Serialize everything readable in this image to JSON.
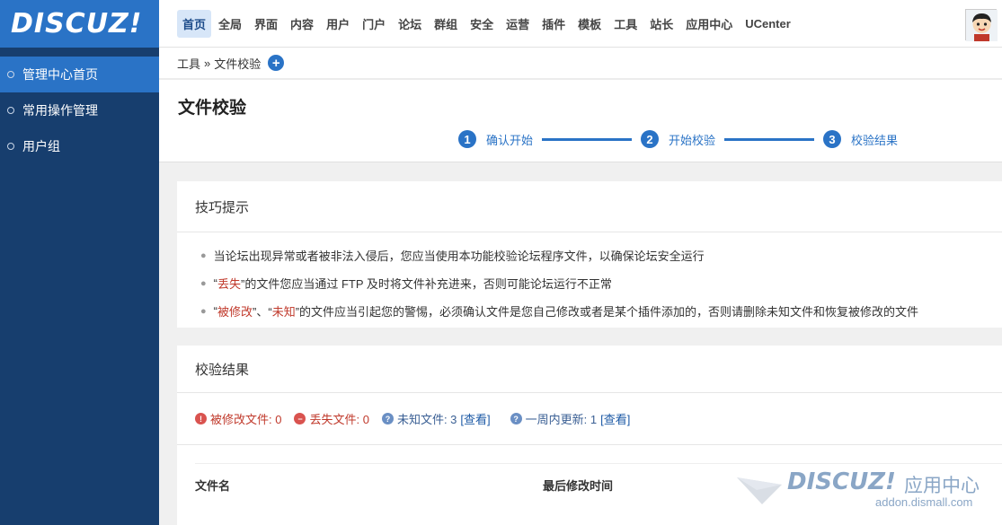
{
  "logo": {
    "text": "DISCUZ!"
  },
  "sidebar": {
    "items": [
      {
        "label": "管理中心首页"
      },
      {
        "label": "常用操作管理"
      },
      {
        "label": "用户组"
      }
    ]
  },
  "topnav": {
    "items": [
      {
        "label": "首页"
      },
      {
        "label": "全局"
      },
      {
        "label": "界面"
      },
      {
        "label": "内容"
      },
      {
        "label": "用户"
      },
      {
        "label": "门户"
      },
      {
        "label": "论坛"
      },
      {
        "label": "群组"
      },
      {
        "label": "安全"
      },
      {
        "label": "运营"
      },
      {
        "label": "插件"
      },
      {
        "label": "模板"
      },
      {
        "label": "工具"
      },
      {
        "label": "站长"
      },
      {
        "label": "应用中心"
      },
      {
        "label": "UCenter"
      }
    ]
  },
  "breadcrumb": {
    "parent": "工具",
    "separator": "»",
    "current": "文件校验"
  },
  "page": {
    "title": "文件校验"
  },
  "steps": [
    {
      "num": "1",
      "label": "确认开始"
    },
    {
      "num": "2",
      "label": "开始校验"
    },
    {
      "num": "3",
      "label": "校验结果"
    }
  ],
  "tips": {
    "title": "技巧提示",
    "items": [
      {
        "text": "当论坛出现异常或者被非法入侵后，您应当使用本功能校验论坛程序文件，以确保论坛安全运行"
      },
      {
        "pre": "“",
        "red": "丢失",
        "text": "”的文件您应当通过 FTP 及时将文件补充进来，否则可能论坛运行不正常"
      },
      {
        "pre": "“",
        "red": "被修改",
        "mid": "”、“",
        "red2": "未知",
        "text": "”的文件应当引起您的警惕，必须确认文件是您自己修改或者是某个插件添加的，否则请删除未知文件和恢复被修改的文件"
      }
    ]
  },
  "results": {
    "title": "校验结果",
    "modified": "被修改文件: 0",
    "lost": "丢失文件: 0",
    "unknown": "未知文件: 3",
    "unknown_link": "[查看]",
    "week": "一周内更新: 1",
    "week_link": "[查看]",
    "col_name": "文件名",
    "col_time": "最后修改时间"
  },
  "watermark": {
    "brand": "DISCUZ!",
    "suffix": "应用中心",
    "url": "addon.dismall.com"
  }
}
